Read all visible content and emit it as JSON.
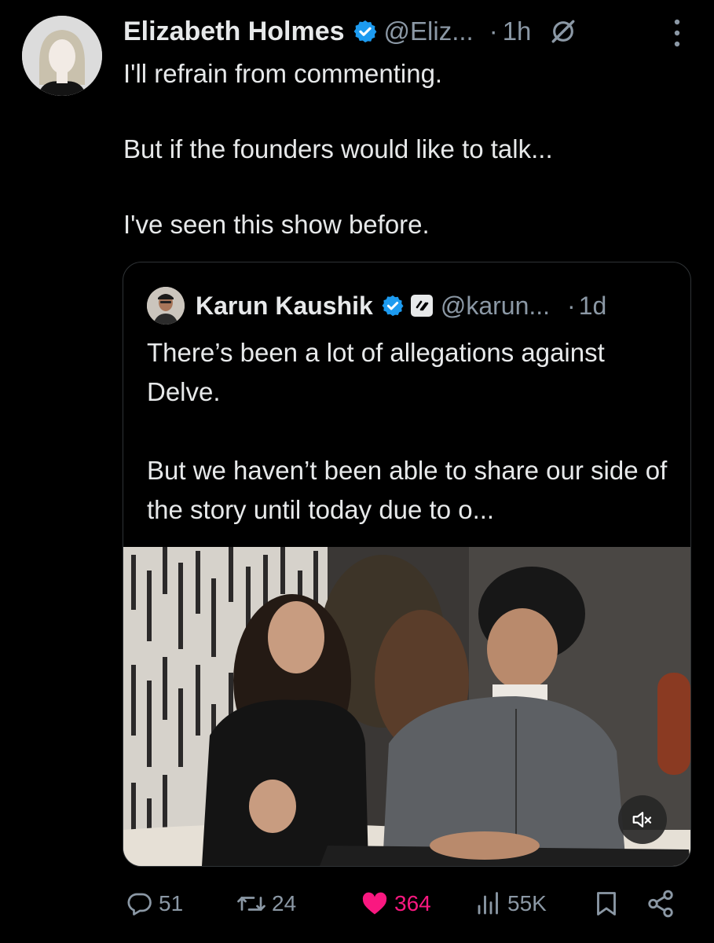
{
  "author": {
    "name": "Elizabeth Holmes",
    "handle": "@Eliz...",
    "separator": "·",
    "time": "1h"
  },
  "tweet": {
    "text": "I'll refrain from commenting.\n\nBut if the founders would like to talk...\n\nI've seen this show before."
  },
  "quote": {
    "name": "Karun Kaushik",
    "handle": "@karun...",
    "separator": "·",
    "time": "1d",
    "text": "There’s been a lot of allegations against Delve.\n\nBut we haven’t been able to share our side of the story until today due to o..."
  },
  "actions": {
    "replies": "51",
    "reposts": "24",
    "likes": "364",
    "views": "55K"
  },
  "icons": {
    "verified": "verified-badge-icon",
    "grok": "grok-icon",
    "more": "more-vertical-icon",
    "affiliate": "affiliate-badge-icon",
    "mute": "muted-speaker-icon",
    "reply": "reply-icon",
    "repost": "repost-icon",
    "like": "heart-filled-icon",
    "views": "views-chart-icon",
    "bookmark": "bookmark-icon",
    "share": "share-icon"
  },
  "colors": {
    "background": "#000000",
    "text": "#e7e9ea",
    "secondary": "#8b98a5",
    "verified": "#1d9bf0",
    "like": "#f91880",
    "border": "#2f3336"
  }
}
